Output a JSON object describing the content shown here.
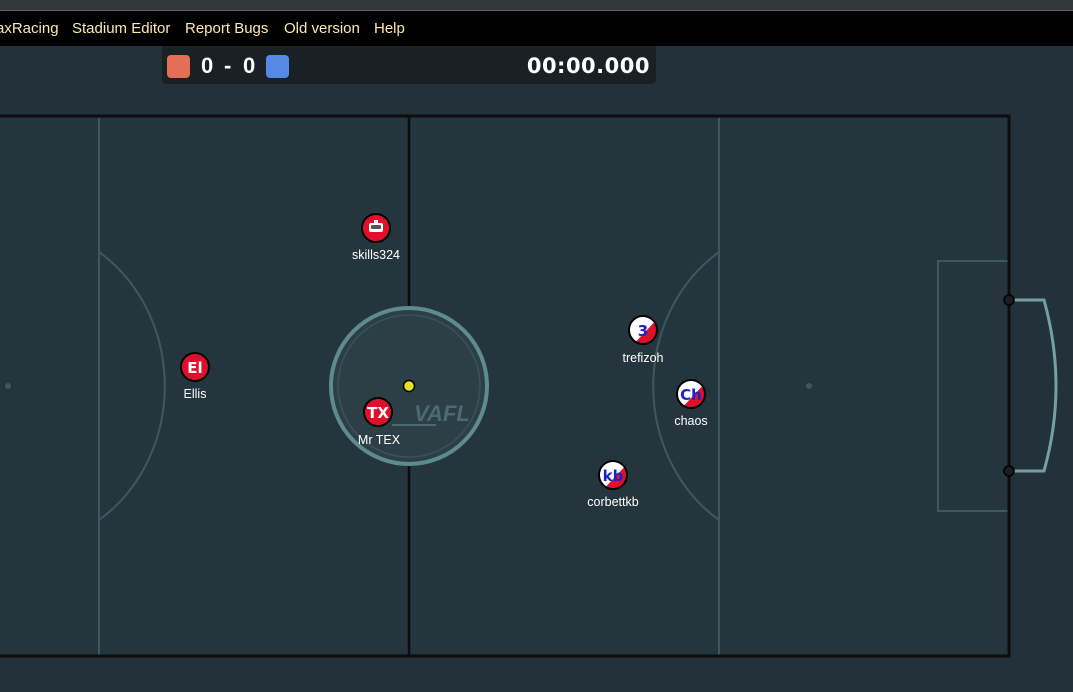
{
  "menu": {
    "items": [
      "axRacing",
      "Stadium Editor",
      "Report Bugs",
      "Old version",
      "Help"
    ]
  },
  "scoreboard": {
    "red_score": "0",
    "separator": "-",
    "blue_score": "0",
    "timer": "00:00.000",
    "red_color": "#e56e56",
    "blue_color": "#5689e5"
  },
  "watermark": "VAFL",
  "players": [
    {
      "name": "skills324",
      "avatar": "robot-icon",
      "team": "red"
    },
    {
      "name": "Ellis",
      "avatar": "El",
      "team": "red"
    },
    {
      "name": "Mr TEX",
      "avatar": "TX",
      "team": "red"
    },
    {
      "name": "trefizoh",
      "avatar": "3",
      "team": "blue"
    },
    {
      "name": "chaos",
      "avatar": "Ch",
      "team": "blue"
    },
    {
      "name": "corbettkb",
      "avatar": "kb",
      "team": "blue"
    }
  ],
  "colors": {
    "background": "#22313a",
    "field": "#25353d",
    "lines": "#3f5860",
    "center_circle": "#5e8c8e",
    "red_team": "#e0102c",
    "blue_team_primary": "#ffffff",
    "blue_team_secondary": "#e0102c",
    "ball": "#e3e325"
  }
}
